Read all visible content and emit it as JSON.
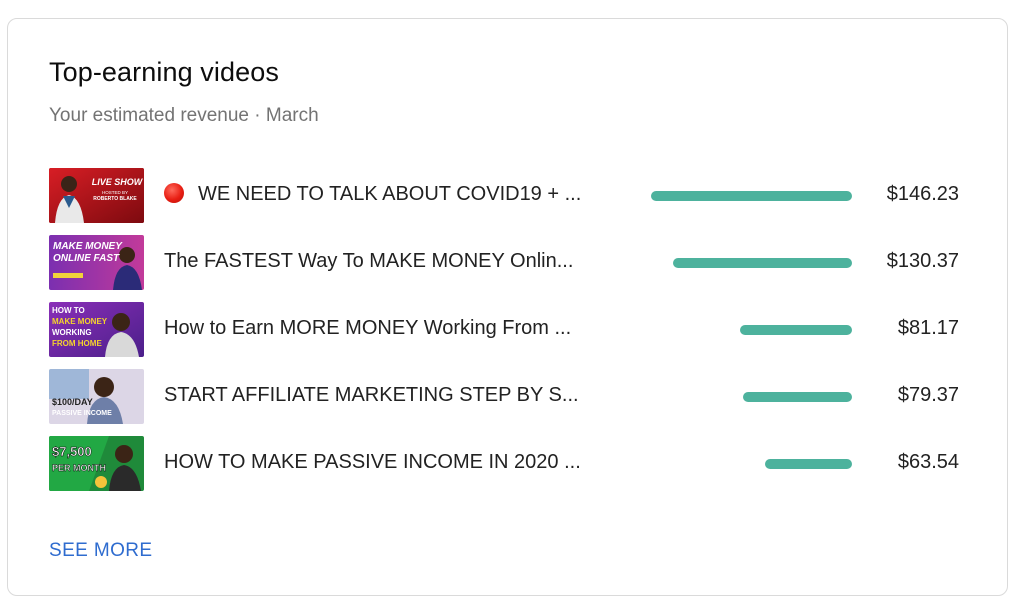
{
  "card": {
    "title": "Top-earning videos",
    "subtitle": "Your estimated revenue · March",
    "see_more_label": "SEE MORE"
  },
  "bar_color": "#4db29d",
  "link_color": "#2f6ccf",
  "videos": [
    {
      "title": "WE NEED TO TALK ABOUT COVID19 + ...",
      "revenue": "$146.23",
      "revenue_value": 146.23,
      "live_icon": "red-circle-icon",
      "thumbnail_text": [
        "LIVE SHOW",
        "HOSTED BY",
        "ROBERTO BLAKE"
      ]
    },
    {
      "title": "The FASTEST Way To MAKE MONEY Onlin...",
      "revenue": "$130.37",
      "revenue_value": 130.37,
      "thumbnail_text": [
        "MAKE MONEY",
        "ONLINE FAST"
      ]
    },
    {
      "title": "How to Earn MORE MONEY Working From ...",
      "revenue": "$81.17",
      "revenue_value": 81.17,
      "thumbnail_text": [
        "HOW TO",
        "MAKE MONEY",
        "WORKING",
        "FROM HOME"
      ]
    },
    {
      "title": "START AFFILIATE MARKETING STEP BY S...",
      "revenue": "$79.37",
      "revenue_value": 79.37,
      "thumbnail_text": [
        "$100/DAY",
        "PASSIVE INCOME"
      ]
    },
    {
      "title": "HOW TO MAKE PASSIVE INCOME IN 2020 ...",
      "revenue": "$63.54",
      "revenue_value": 63.54,
      "thumbnail_text": [
        "$7,500",
        "PER MONTH"
      ]
    }
  ]
}
